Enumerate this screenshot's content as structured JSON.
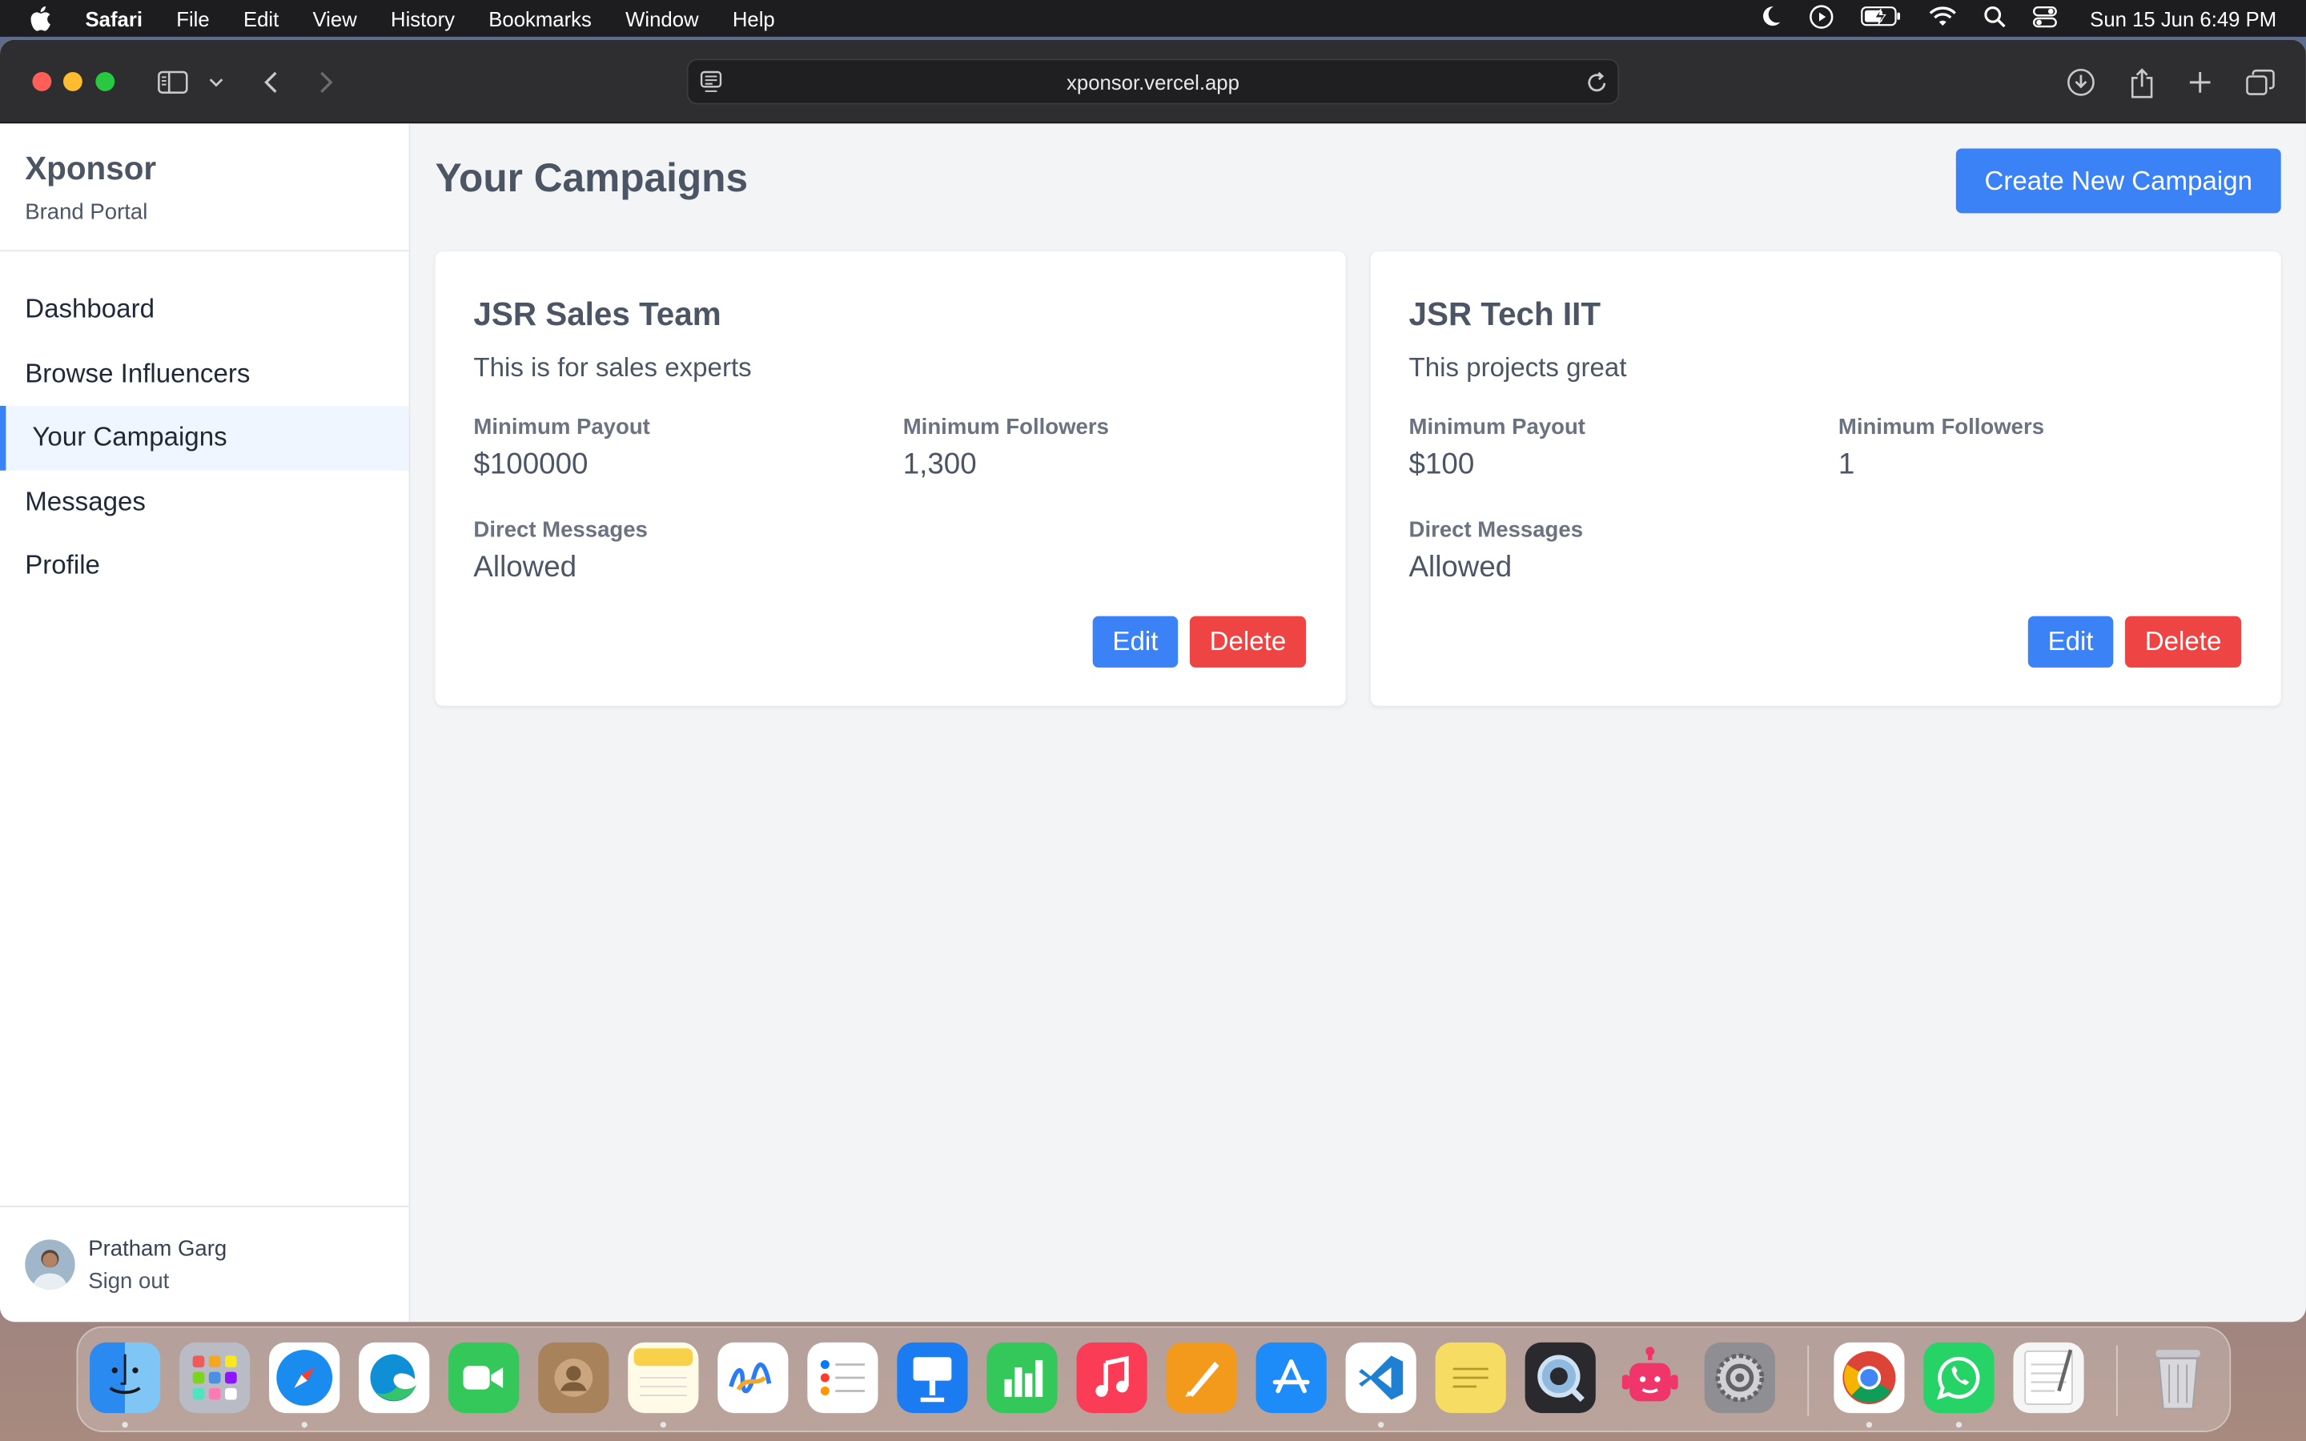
{
  "menubar": {
    "app_name": "Safari",
    "menus": [
      "File",
      "Edit",
      "View",
      "History",
      "Bookmarks",
      "Window",
      "Help"
    ],
    "clock": "Sun 15 Jun  6:49 PM"
  },
  "browser": {
    "url": "xponsor.vercel.app"
  },
  "sidebar": {
    "brand_title": "Xponsor",
    "brand_subtitle": "Brand Portal",
    "items": [
      {
        "label": "Dashboard"
      },
      {
        "label": "Browse Influencers"
      },
      {
        "label": "Your Campaigns"
      },
      {
        "label": "Messages"
      },
      {
        "label": "Profile"
      }
    ],
    "active_item": "Your Campaigns",
    "user_name": "Pratham Garg",
    "sign_out": "Sign out"
  },
  "main": {
    "page_title": "Your Campaigns",
    "create_button": "Create New Campaign",
    "campaigns": [
      {
        "title": "JSR Sales Team",
        "description": "This is for sales experts",
        "payout_label": "Minimum Payout",
        "payout": "$100000",
        "followers_label": "Minimum Followers",
        "followers": "1,300",
        "dm_label": "Direct Messages",
        "dm": "Allowed",
        "edit": "Edit",
        "delete": "Delete"
      },
      {
        "title": "JSR Tech IIT",
        "description": "This projects great",
        "payout_label": "Minimum Payout",
        "payout": "$100",
        "followers_label": "Minimum Followers",
        "followers": "1",
        "dm_label": "Direct Messages",
        "dm": "Allowed",
        "edit": "Edit",
        "delete": "Delete"
      }
    ]
  },
  "colors": {
    "accent": "#3b82f6",
    "danger": "#ef4444",
    "background": "#f3f4f6"
  },
  "dock": {
    "apps": [
      "finder-icon",
      "launchpad-icon",
      "safari-icon",
      "edge-icon",
      "facetime-icon",
      "contacts-icon",
      "notes-icon",
      "freeform-icon",
      "reminders-icon",
      "keynote-icon",
      "numbers-icon",
      "music-icon",
      "pages-icon",
      "app-store-icon",
      "vscode-icon",
      "stickies-icon",
      "quicktime-icon",
      "robot-app-icon",
      "system-settings-icon",
      "chrome-icon",
      "whatsapp-icon",
      "textedit-icon",
      "trash-icon"
    ]
  }
}
